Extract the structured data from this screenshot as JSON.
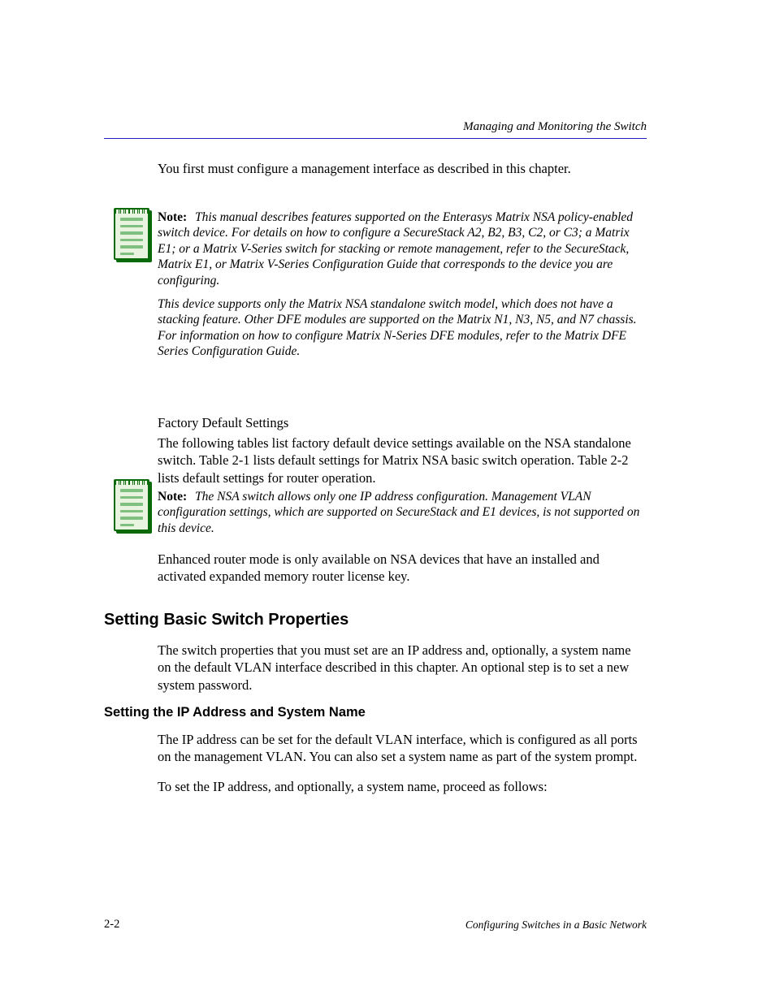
{
  "header": {
    "title": "Managing and Monitoring the Switch",
    "rule_color": "#2020c0"
  },
  "intro": "You first must configure a management interface as described in this chapter.",
  "notes": [
    {
      "label": "Note:",
      "paragraphs": [
        "This manual describes features supported on the Enterasys Matrix NSA policy-enabled switch device. For details on how to configure a SecureStack A2, B2, B3, C2, or C3; a Matrix E1; or a Matrix V-Series switch for stacking or remote management, refer to the SecureStack, Matrix E1, or Matrix V-Series Configuration Guide that corresponds to the device you are configuring.",
        "This device supports only the Matrix NSA standalone switch model, which does not have a stacking feature. Other DFE modules are supported on the Matrix N1, N3, N5, and N7 chassis. For information on how to configure Matrix N-Series DFE modules, refer to the Matrix DFE Series Configuration Guide."
      ]
    },
    {
      "label": "Note:",
      "paragraphs": [
        "The NSA switch allows only one IP address configuration. Management VLAN configuration settings, which are supported on SecureStack and E1 devices, is not supported on this device."
      ]
    }
  ],
  "body": {
    "factory": "Factory Default Settings",
    "p1": "The following tables list factory default device settings available on the NSA standalone switch. Table 2-1 lists default settings for Matrix NSA basic switch operation. Table 2-2 lists default settings for router operation.",
    "p2": "Enhanced router mode is only available on NSA devices that have an installed and activated expanded memory router license key.",
    "heading1": "Setting Basic Switch Properties",
    "p3": "The switch properties that you must set are an IP address and, optionally, a system name on the default VLAN interface described in this chapter. An optional step is to set a new system password.",
    "heading2": "Setting the IP Address and System Name",
    "p4": "The IP address can be set for the default VLAN interface, which is configured as all ports on the management VLAN. You can also set a system name as part of the system prompt.",
    "p5": "To set the IP address, and optionally, a system name, proceed as follows:"
  },
  "footer": {
    "left": "2-2",
    "right": "Configuring Switches in a Basic Network"
  }
}
